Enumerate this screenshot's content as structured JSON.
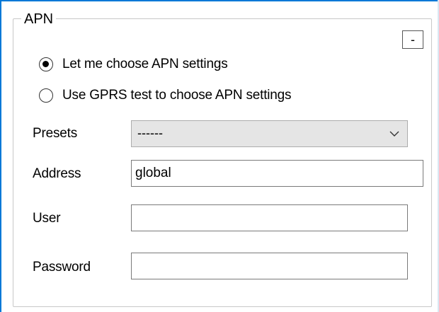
{
  "group": {
    "title": "APN",
    "collapse_label": "-"
  },
  "radios": [
    {
      "label": "Let me choose APN settings",
      "checked": true
    },
    {
      "label": "Use GPRS test to choose APN settings",
      "checked": false
    }
  ],
  "fields": {
    "presets": {
      "label": "Presets",
      "value": "------"
    },
    "address": {
      "label": "Address",
      "value": "global"
    },
    "user": {
      "label": "User",
      "value": ""
    },
    "password": {
      "label": "Password",
      "value": ""
    }
  },
  "colors": {
    "accent": "#0078d7",
    "select_bg": "#e5e5e5"
  },
  "icons": {
    "dropdown": "chevron-down-icon"
  }
}
